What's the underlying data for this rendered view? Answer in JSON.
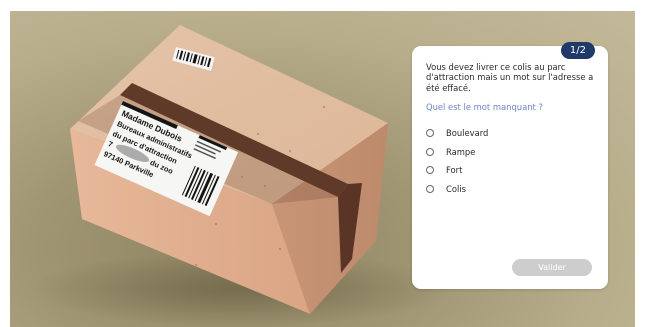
{
  "quiz": {
    "progress": "1/2",
    "prompt": "Vous devez livrer ce colis au parc d'attraction mais un mot sur l'adresse a été effacé.",
    "question": "Quel est le mot manquant ?",
    "options": [
      "Boulevard",
      "Rampe",
      "Fort",
      "Colis"
    ],
    "submit_label": "Valider"
  },
  "label": {
    "line1": "Madame Dubois",
    "line2": "Bureaux administratifs",
    "line3": "du parc d'attraction",
    "line4_prefix": "7",
    "line4_suffix": "du zoo",
    "line5": "97140 Parkville"
  },
  "colors": {
    "badge": "#1f3a68",
    "question": "#6f86c4",
    "button": "#cdcdcd"
  }
}
